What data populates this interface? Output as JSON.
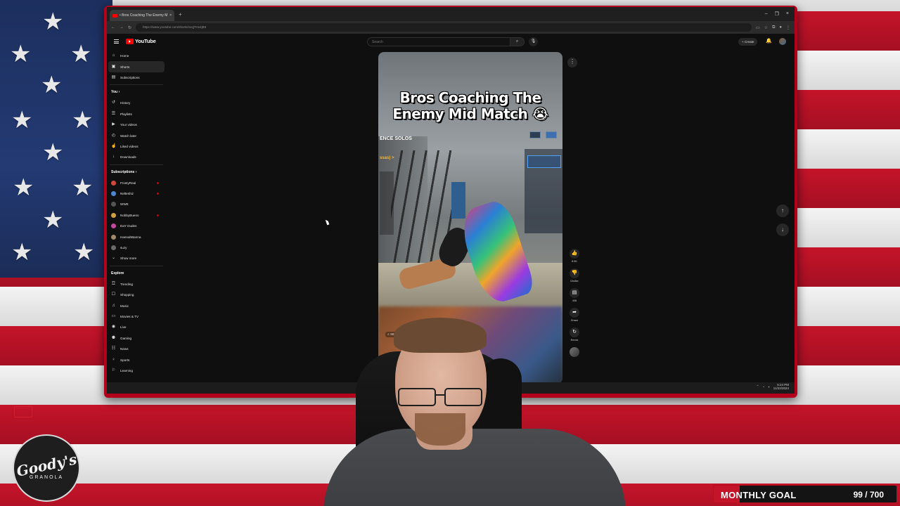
{
  "browser": {
    "tab_title": "• Bros Coaching The Enemy Mi",
    "url": "https://www.youtube.com/shorts/vxqjTHx4jB8"
  },
  "youtube": {
    "logo_text": "YouTube",
    "search_placeholder": "Search",
    "create_label": "+ Create",
    "nav": [
      {
        "label": "Home",
        "icon": "home-icon",
        "glyph": "⌂"
      },
      {
        "label": "Shorts",
        "icon": "shorts-icon",
        "glyph": "▣",
        "active": true
      },
      {
        "label": "Subscriptions",
        "icon": "subscriptions-icon",
        "glyph": "▤"
      }
    ],
    "you_heading": "You ›",
    "you_items": [
      {
        "label": "History",
        "icon": "history-icon",
        "glyph": "↺"
      },
      {
        "label": "Playlists",
        "icon": "playlists-icon",
        "glyph": "☰"
      },
      {
        "label": "Your videos",
        "icon": "your-videos-icon",
        "glyph": "▶"
      },
      {
        "label": "Watch later",
        "icon": "watch-later-icon",
        "glyph": "◴"
      },
      {
        "label": "Liked videos",
        "icon": "liked-videos-icon",
        "glyph": "☝"
      },
      {
        "label": "Downloads",
        "icon": "downloads-icon",
        "glyph": "↓"
      }
    ],
    "subscriptions_heading": "Subscriptions ›",
    "subscriptions": [
      {
        "label": "FrostyReal",
        "color": "#d04a3a",
        "live": true
      },
      {
        "label": "Nelteshiz",
        "color": "#4a8ad0",
        "live": true
      },
      {
        "label": "WWE",
        "color": "#555555",
        "live": false
      },
      {
        "label": "NobbyBueno",
        "color": "#d0a03a",
        "live": true
      },
      {
        "label": "DaY Dudes",
        "color": "#c04aa0",
        "live": false
      },
      {
        "label": "HannahBanna",
        "color": "#a08a6a",
        "live": false
      },
      {
        "label": "suzy",
        "color": "#6a6a6a",
        "live": false
      }
    ],
    "show_more": "Show more",
    "explore_heading": "Explore",
    "explore": [
      {
        "label": "Trending",
        "icon": "trending-icon",
        "glyph": "☲"
      },
      {
        "label": "Shopping",
        "icon": "shopping-icon",
        "glyph": "☐"
      },
      {
        "label": "Music",
        "icon": "music-icon",
        "glyph": "♫"
      },
      {
        "label": "Movies & TV",
        "icon": "movies-icon",
        "glyph": "▭"
      },
      {
        "label": "Live",
        "icon": "live-icon",
        "glyph": "◉"
      },
      {
        "label": "Gaming",
        "icon": "gaming-icon",
        "glyph": "⚉"
      },
      {
        "label": "News",
        "icon": "news-icon",
        "glyph": "☷"
      },
      {
        "label": "Sports",
        "icon": "sports-icon",
        "glyph": "♀"
      },
      {
        "label": "Learning",
        "icon": "learning-icon",
        "glyph": "⚐"
      }
    ]
  },
  "short": {
    "title_line1": "Bros Coaching The",
    "title_line2": "Enemy Mid Match 😭",
    "overlay_text": "ENCE SOLOS",
    "overlay_sub": "ssas) >",
    "search_chip": "search"
  },
  "actions": [
    {
      "name": "like-button",
      "glyph": "👍",
      "label": "8.5K"
    },
    {
      "name": "dislike-button",
      "glyph": "👎",
      "label": "Dislike"
    },
    {
      "name": "comments-button",
      "glyph": "▤",
      "label": "408"
    },
    {
      "name": "share-button",
      "glyph": "➦",
      "label": "Share"
    },
    {
      "name": "remix-button",
      "glyph": "↻",
      "label": "Remix"
    }
  ],
  "taskbar": {
    "time": "5:24 PM",
    "date": "11/22/2024"
  },
  "stream": {
    "sponsor_brand": "Goody's",
    "sponsor_sub": "GRANOLA",
    "goal_label": "MONTHLY GOAL",
    "goal_count": "99 / 700",
    "goal_current": 99,
    "goal_target": 700
  }
}
